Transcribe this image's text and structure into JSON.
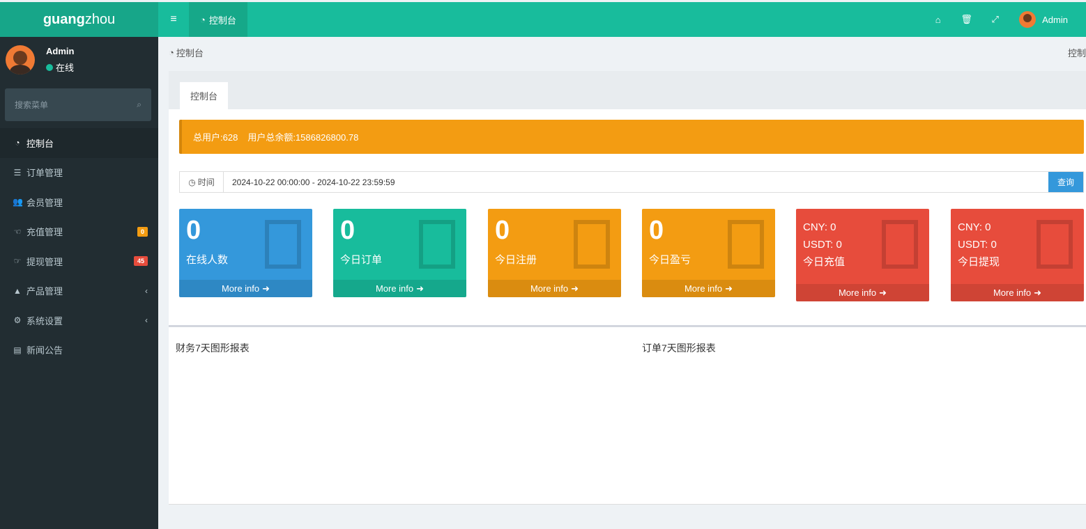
{
  "brand": {
    "bold": "guang",
    "light": "zhou"
  },
  "topbar": {
    "menu_icon": "bars-icon",
    "tab_label": "控制台",
    "tab_icon": "dashboard-icon",
    "icons": [
      "home-icon",
      "trash-icon",
      "expand-icon"
    ],
    "user_name": "Admin"
  },
  "sidebar": {
    "user_name": "Admin",
    "status": "在线",
    "search_placeholder": "搜索菜单",
    "items": [
      {
        "icon": "dashboard-icon",
        "label": "控制台",
        "active": true
      },
      {
        "icon": "list-icon",
        "label": "订单管理"
      },
      {
        "icon": "users-icon",
        "label": "会员管理"
      },
      {
        "icon": "hand-icon",
        "label": "充值管理",
        "badge": "0",
        "badge_color": "#f39c12"
      },
      {
        "icon": "hand-left-icon",
        "label": "提现管理",
        "badge": "45",
        "badge_color": "#e74c3c"
      },
      {
        "icon": "shopping-bag-icon",
        "label": "产品管理",
        "submenu": true
      },
      {
        "icon": "cogs-icon",
        "label": "系统设置",
        "submenu": true
      },
      {
        "icon": "newspaper-icon",
        "label": "新闻公告"
      }
    ]
  },
  "breadcrumb": {
    "label": "控制台",
    "right": "控制"
  },
  "panel": {
    "tab_label": "控制台",
    "alert": {
      "total_users": "总用户:628",
      "total_balance": "用户总余额:1586826800.78"
    },
    "date": {
      "addon": "时间",
      "value": "2024-10-22 00:00:00 - 2024-10-22 23:59:59",
      "button": "查询"
    },
    "boxes": [
      {
        "num": "0",
        "label": "在线人数",
        "color": "#3498db",
        "footer": "More info"
      },
      {
        "num": "0",
        "label": "今日订单",
        "color": "#18bc9c",
        "footer": "More info"
      },
      {
        "num": "0",
        "label": "今日注册",
        "color": "#f39c12",
        "footer": "More info"
      },
      {
        "num": "0",
        "label": "今日盈亏",
        "color": "#f39c12",
        "footer": "More info"
      },
      {
        "cny": "CNY:  0",
        "usdt": "USDT:  0",
        "label": "今日充值",
        "color": "#e74c3c",
        "footer": "More info"
      },
      {
        "cny": "CNY:  0",
        "usdt": "USDT:  0",
        "label": "今日提现",
        "color": "#e74c3c",
        "footer": "More info"
      }
    ],
    "chart_titles": [
      "财务7天图形报表",
      "订单7天图形报表"
    ]
  }
}
